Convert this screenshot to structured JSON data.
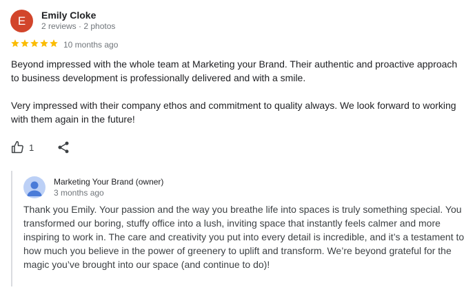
{
  "review": {
    "author": {
      "initial": "E",
      "avatar_color": "#d2452b",
      "name": "Emily Cloke",
      "meta": "2 reviews · 2 photos"
    },
    "rating": 5,
    "star_color": "#fbbc04",
    "date": "10 months ago",
    "paragraphs": [
      "Beyond impressed with the whole team at Marketing your Brand. Their authentic and proactive approach to business development is professionally delivered and with a smile.",
      "Very impressed with their company ethos and commitment to quality always. We look forward to working with them again in the future!"
    ],
    "actions": {
      "like_icon": "thumb-up-icon",
      "like_count": "1",
      "share_icon": "share-icon"
    }
  },
  "owner_reply": {
    "name": "Marketing Your Brand (owner)",
    "date": "3 months ago",
    "avatar_icon": "person-icon",
    "text": "Thank you Emily. Your passion and the way you breathe life into spaces is truly something special. You transformed our boring, stuffy office into a lush, inviting space that instantly feels calmer and more inspiring to work in. The care and creativity you put into every detail is incredible, and it’s a testament to how much you believe in the power of greenery to uplift and transform. We’re beyond grateful for the magic you’ve brought into our space (and continue to do)!"
  }
}
